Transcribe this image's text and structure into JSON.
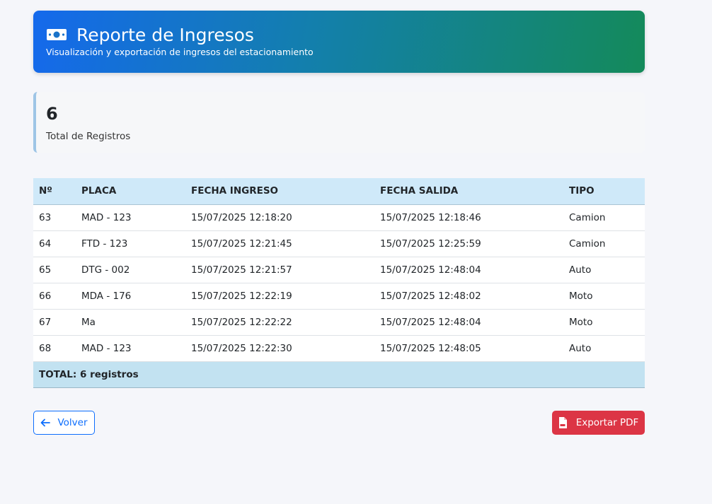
{
  "header": {
    "icon": "money-bill-icon",
    "title": "Reporte de Ingresos",
    "subtitle": "Visualización y exportación de ingresos del estacionamiento",
    "gradient_from": "#1569ec",
    "gradient_to": "#148a5a"
  },
  "summary": {
    "total_value": "6",
    "total_label": "Total de Registros"
  },
  "table": {
    "columns": [
      "Nº",
      "PLACA",
      "FECHA INGRESO",
      "FECHA SALIDA",
      "TIPO"
    ],
    "rows": [
      [
        "63",
        "MAD - 123",
        "15/07/2025 12:18:20",
        "15/07/2025 12:18:46",
        "Camion"
      ],
      [
        "64",
        "FTD - 123",
        "15/07/2025 12:21:45",
        "15/07/2025 12:25:59",
        "Camion"
      ],
      [
        "65",
        "DTG - 002",
        "15/07/2025 12:21:57",
        "15/07/2025 12:48:04",
        "Auto"
      ],
      [
        "66",
        "MDA - 176",
        "15/07/2025 12:22:19",
        "15/07/2025 12:48:02",
        "Moto"
      ],
      [
        "67",
        "Ma",
        "15/07/2025 12:22:22",
        "15/07/2025 12:48:04",
        "Moto"
      ],
      [
        "68",
        "MAD - 123",
        "15/07/2025 12:22:30",
        "15/07/2025 12:48:05",
        "Auto"
      ]
    ],
    "total_label": "TOTAL: 6 registros"
  },
  "actions": {
    "back_label": "Volver",
    "back_icon": "arrow-left-icon",
    "export_label": "Exportar PDF",
    "export_icon": "file-pdf-icon",
    "export_color": "#dc3545",
    "back_color": "#0d6efd"
  }
}
